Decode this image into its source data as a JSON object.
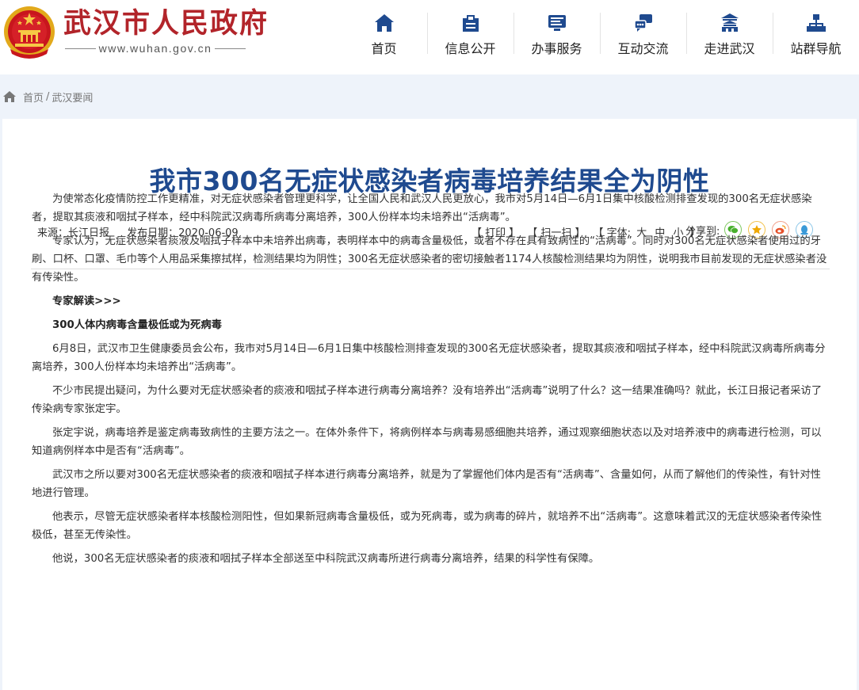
{
  "site": {
    "name": "武汉市人民政府",
    "url": "www.wuhan.gov.cn"
  },
  "nav": [
    {
      "label": "首页",
      "icon": "home-icon"
    },
    {
      "label": "信息公开",
      "icon": "document-icon"
    },
    {
      "label": "办事服务",
      "icon": "monitor-icon"
    },
    {
      "label": "互动交流",
      "icon": "chat-icon"
    },
    {
      "label": "走进武汉",
      "icon": "building-icon"
    },
    {
      "label": "站群导航",
      "icon": "sitemap-icon"
    }
  ],
  "breadcrumb": {
    "home": "首页",
    "separator": "/",
    "current": "武汉要闻"
  },
  "article": {
    "title": "我市300名无症状感染者病毒培养结果全为阴性",
    "source": "来源：长江日报",
    "date": "发布日期：2020-06-09",
    "tools": {
      "print": "【 打印 】",
      "scan": "【 扫一扫 】",
      "font_prefix": "【 字体:",
      "font_large": "大",
      "font_medium": "中",
      "font_small": "小",
      "font_suffix": "】"
    },
    "share_label": "分享到:",
    "paragraphs": [
      "为使常态化疫情防控工作更精准，对无症状感染者管理更科学，让全国人民和武汉人民更放心，我市对5月14日—6月1日集中核酸检测排查发现的300名无症状感染者，提取其痰液和咽拭子样本，经中科院武汉病毒所病毒分离培养，300人份样本均未培养出“活病毒”。",
      "专家认为，无症状感染者痰液及咽拭子样本中未培养出病毒，表明样本中的病毒含量极低，或者不存在具有致病性的“活病毒”。同时对300名无症状感染者使用过的牙刷、口杯、口罩、毛巾等个人用品采集擦拭样，检测结果均为阴性；300名无症状感染者的密切接触者1174人核酸检测结果均为阴性，说明我市目前发现的无症状感染者没有传染性。",
      "专家解读>>>",
      "300人体内病毒含量极低或为死病毒",
      "6月8日，武汉市卫生健康委员会公布，我市对5月14日—6月1日集中核酸检测排查发现的300名无症状感染者，提取其痰液和咽拭子样本，经中科院武汉病毒所病毒分离培养，300人份样本均未培养出“活病毒”。",
      "不少市民提出疑问，为什么要对无症状感染者的痰液和咽拭子样本进行病毒分离培养？没有培养出“活病毒”说明了什么？这一结果准确吗？就此，长江日报记者采访了传染病专家张定宇。",
      "张定宇说，病毒培养是鉴定病毒致病性的主要方法之一。在体外条件下，将病例样本与病毒易感细胞共培养，通过观察细胞状态以及对培养液中的病毒进行检测，可以知道病例样本中是否有“活病毒”。",
      "武汉市之所以要对300名无症状感染者的痰液和咽拭子样本进行病毒分离培养，就是为了掌握他们体内是否有“活病毒”、含量如何，从而了解他们的传染性，有针对性地进行管理。",
      "他表示，尽管无症状感染者样本核酸检测阳性，但如果新冠病毒含量极低，或为死病毒，或为病毒的碎片，就培养不出“活病毒”。这意味着武汉的无症状感染者传染性极低，甚至无传染性。",
      "他说，300名无症状感染者的痰液和咽拭子样本全部送至中科院武汉病毒所进行病毒分离培养，结果的科学性有保障。"
    ]
  },
  "colors": {
    "brand_red": "#b2242a",
    "title_blue": "#1f4a8f",
    "nav_icon_blue": "#1f4a8f",
    "page_bg": "#eef3fa"
  }
}
